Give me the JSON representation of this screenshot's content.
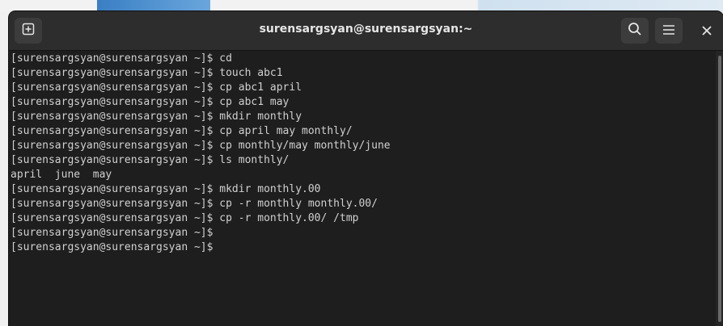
{
  "window": {
    "title": "surensargsyan@surensargsyan:~"
  },
  "header": {
    "new_tab_icon": "new-tab-icon",
    "search_icon": "search-icon",
    "menu_icon": "hamburger-menu-icon",
    "close_icon": "close-icon"
  },
  "terminal": {
    "lines": [
      "[surensargsyan@surensargsyan ~]$ cd",
      "[surensargsyan@surensargsyan ~]$ touch abc1",
      "[surensargsyan@surensargsyan ~]$ cp abc1 april",
      "[surensargsyan@surensargsyan ~]$ cp abc1 may",
      "[surensargsyan@surensargsyan ~]$ mkdir monthly",
      "[surensargsyan@surensargsyan ~]$ cp april may monthly/",
      "[surensargsyan@surensargsyan ~]$ cp monthly/may monthly/june",
      "[surensargsyan@surensargsyan ~]$ ls monthly/",
      "april  june  may",
      "[surensargsyan@surensargsyan ~]$ mkdir monthly.00",
      "[surensargsyan@surensargsyan ~]$ cp -r monthly monthly.00/",
      "[surensargsyan@surensargsyan ~]$ cp -r monthly.00/ /tmp",
      "[surensargsyan@surensargsyan ~]$",
      "[surensargsyan@surensargsyan ~]$"
    ]
  },
  "colors": {
    "terminal_bg": "#1e1e1e",
    "header_bg": "#2d2d2d",
    "text": "#d0d0d0",
    "title_text": "#e6e6e6"
  }
}
